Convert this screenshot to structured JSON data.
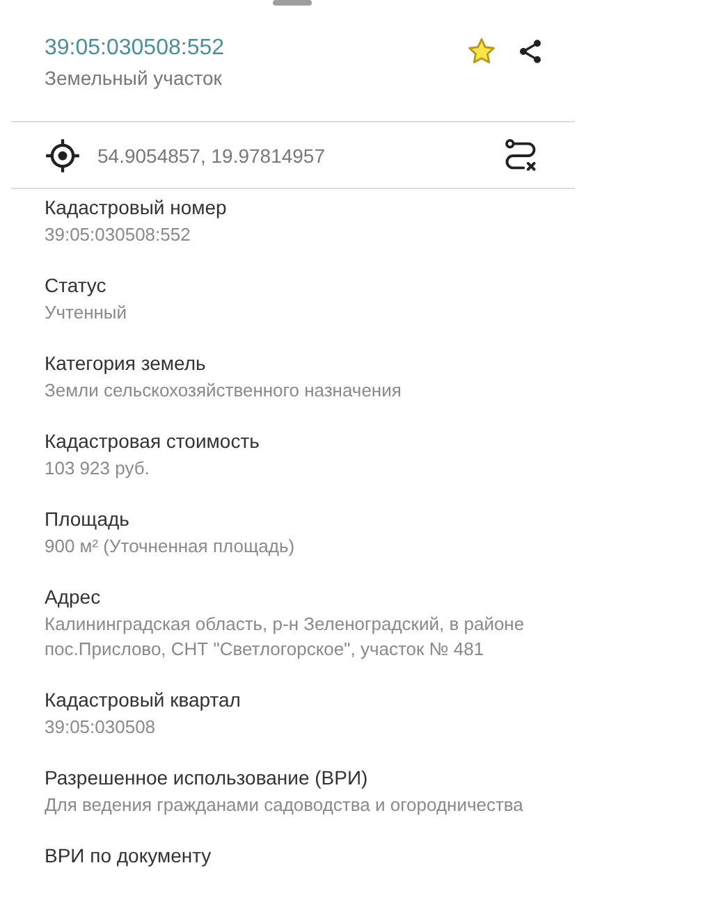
{
  "header": {
    "title": "39:05:030508:552",
    "subtitle": "Земельный участок",
    "favorite": true
  },
  "location": {
    "coordinates": "54.9054857, 19.97814957"
  },
  "fields": [
    {
      "label": "Кадастровый номер",
      "value": "39:05:030508:552"
    },
    {
      "label": "Статус",
      "value": "Учтенный"
    },
    {
      "label": "Категория земель",
      "value": "Земли сельскохозяйственного назначения"
    },
    {
      "label": "Кадастровая стоимость",
      "value": "103 923 руб."
    },
    {
      "label": "Площадь",
      "value": "900 м² (Уточненная площадь)"
    },
    {
      "label": "Адрес",
      "value": "Калининградская область, р-н Зеленоградский, в районе пос.Прислово, СНТ \"Светлогорское\", участок № 481"
    },
    {
      "label": "Кадастровый квартал",
      "value": "39:05:030508"
    },
    {
      "label": "Разрешенное использование (ВРИ)",
      "value": "Для ведения гражданами садоводства и огородничества"
    },
    {
      "label": "ВРИ по документу"
    }
  ]
}
